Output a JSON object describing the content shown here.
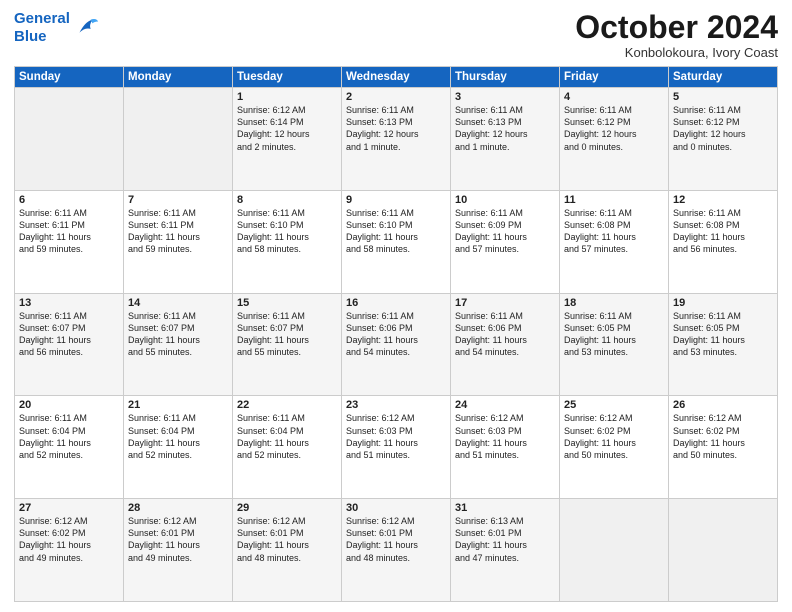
{
  "header": {
    "logo_line1": "General",
    "logo_line2": "Blue",
    "month": "October 2024",
    "location": "Konbolokoura, Ivory Coast"
  },
  "weekdays": [
    "Sunday",
    "Monday",
    "Tuesday",
    "Wednesday",
    "Thursday",
    "Friday",
    "Saturday"
  ],
  "weeks": [
    [
      {
        "day": "",
        "content": ""
      },
      {
        "day": "",
        "content": ""
      },
      {
        "day": "1",
        "content": "Sunrise: 6:12 AM\nSunset: 6:14 PM\nDaylight: 12 hours\nand 2 minutes."
      },
      {
        "day": "2",
        "content": "Sunrise: 6:11 AM\nSunset: 6:13 PM\nDaylight: 12 hours\nand 1 minute."
      },
      {
        "day": "3",
        "content": "Sunrise: 6:11 AM\nSunset: 6:13 PM\nDaylight: 12 hours\nand 1 minute."
      },
      {
        "day": "4",
        "content": "Sunrise: 6:11 AM\nSunset: 6:12 PM\nDaylight: 12 hours\nand 0 minutes."
      },
      {
        "day": "5",
        "content": "Sunrise: 6:11 AM\nSunset: 6:12 PM\nDaylight: 12 hours\nand 0 minutes."
      }
    ],
    [
      {
        "day": "6",
        "content": "Sunrise: 6:11 AM\nSunset: 6:11 PM\nDaylight: 11 hours\nand 59 minutes."
      },
      {
        "day": "7",
        "content": "Sunrise: 6:11 AM\nSunset: 6:11 PM\nDaylight: 11 hours\nand 59 minutes."
      },
      {
        "day": "8",
        "content": "Sunrise: 6:11 AM\nSunset: 6:10 PM\nDaylight: 11 hours\nand 58 minutes."
      },
      {
        "day": "9",
        "content": "Sunrise: 6:11 AM\nSunset: 6:10 PM\nDaylight: 11 hours\nand 58 minutes."
      },
      {
        "day": "10",
        "content": "Sunrise: 6:11 AM\nSunset: 6:09 PM\nDaylight: 11 hours\nand 57 minutes."
      },
      {
        "day": "11",
        "content": "Sunrise: 6:11 AM\nSunset: 6:08 PM\nDaylight: 11 hours\nand 57 minutes."
      },
      {
        "day": "12",
        "content": "Sunrise: 6:11 AM\nSunset: 6:08 PM\nDaylight: 11 hours\nand 56 minutes."
      }
    ],
    [
      {
        "day": "13",
        "content": "Sunrise: 6:11 AM\nSunset: 6:07 PM\nDaylight: 11 hours\nand 56 minutes."
      },
      {
        "day": "14",
        "content": "Sunrise: 6:11 AM\nSunset: 6:07 PM\nDaylight: 11 hours\nand 55 minutes."
      },
      {
        "day": "15",
        "content": "Sunrise: 6:11 AM\nSunset: 6:07 PM\nDaylight: 11 hours\nand 55 minutes."
      },
      {
        "day": "16",
        "content": "Sunrise: 6:11 AM\nSunset: 6:06 PM\nDaylight: 11 hours\nand 54 minutes."
      },
      {
        "day": "17",
        "content": "Sunrise: 6:11 AM\nSunset: 6:06 PM\nDaylight: 11 hours\nand 54 minutes."
      },
      {
        "day": "18",
        "content": "Sunrise: 6:11 AM\nSunset: 6:05 PM\nDaylight: 11 hours\nand 53 minutes."
      },
      {
        "day": "19",
        "content": "Sunrise: 6:11 AM\nSunset: 6:05 PM\nDaylight: 11 hours\nand 53 minutes."
      }
    ],
    [
      {
        "day": "20",
        "content": "Sunrise: 6:11 AM\nSunset: 6:04 PM\nDaylight: 11 hours\nand 52 minutes."
      },
      {
        "day": "21",
        "content": "Sunrise: 6:11 AM\nSunset: 6:04 PM\nDaylight: 11 hours\nand 52 minutes."
      },
      {
        "day": "22",
        "content": "Sunrise: 6:11 AM\nSunset: 6:04 PM\nDaylight: 11 hours\nand 52 minutes."
      },
      {
        "day": "23",
        "content": "Sunrise: 6:12 AM\nSunset: 6:03 PM\nDaylight: 11 hours\nand 51 minutes."
      },
      {
        "day": "24",
        "content": "Sunrise: 6:12 AM\nSunset: 6:03 PM\nDaylight: 11 hours\nand 51 minutes."
      },
      {
        "day": "25",
        "content": "Sunrise: 6:12 AM\nSunset: 6:02 PM\nDaylight: 11 hours\nand 50 minutes."
      },
      {
        "day": "26",
        "content": "Sunrise: 6:12 AM\nSunset: 6:02 PM\nDaylight: 11 hours\nand 50 minutes."
      }
    ],
    [
      {
        "day": "27",
        "content": "Sunrise: 6:12 AM\nSunset: 6:02 PM\nDaylight: 11 hours\nand 49 minutes."
      },
      {
        "day": "28",
        "content": "Sunrise: 6:12 AM\nSunset: 6:01 PM\nDaylight: 11 hours\nand 49 minutes."
      },
      {
        "day": "29",
        "content": "Sunrise: 6:12 AM\nSunset: 6:01 PM\nDaylight: 11 hours\nand 48 minutes."
      },
      {
        "day": "30",
        "content": "Sunrise: 6:12 AM\nSunset: 6:01 PM\nDaylight: 11 hours\nand 48 minutes."
      },
      {
        "day": "31",
        "content": "Sunrise: 6:13 AM\nSunset: 6:01 PM\nDaylight: 11 hours\nand 47 minutes."
      },
      {
        "day": "",
        "content": ""
      },
      {
        "day": "",
        "content": ""
      }
    ]
  ]
}
